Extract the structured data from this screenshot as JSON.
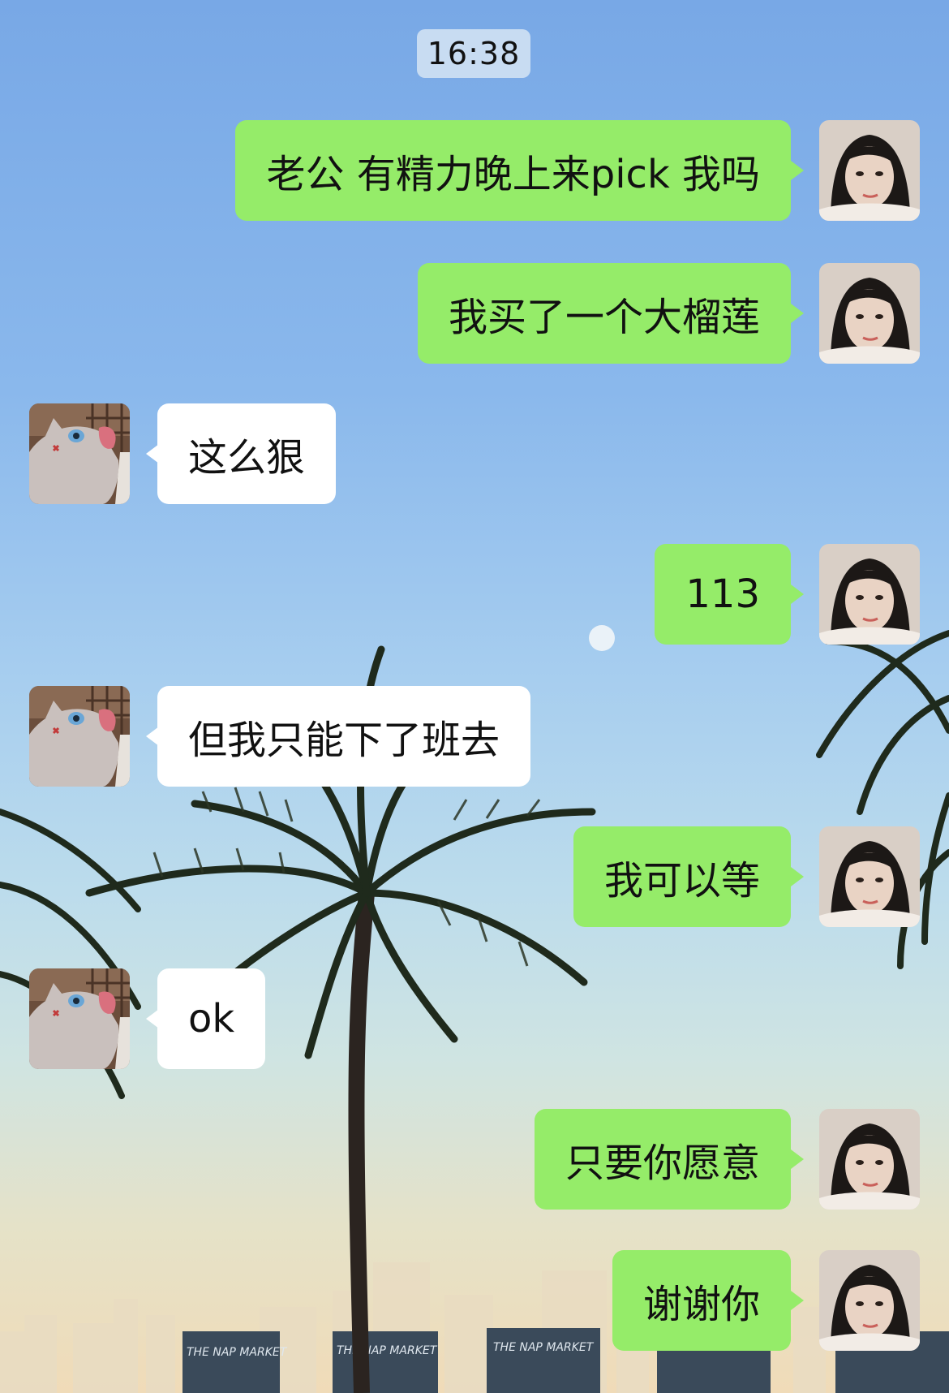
{
  "chat": {
    "timestamp": "16:38",
    "messages": [
      {
        "from": "me",
        "text": "老公 有精力晚上来pick 我吗"
      },
      {
        "from": "me",
        "text": "我买了一个大榴莲"
      },
      {
        "from": "them",
        "text": "这么狠"
      },
      {
        "from": "me",
        "text": "113"
      },
      {
        "from": "them",
        "text": "但我只能下了班去"
      },
      {
        "from": "me",
        "text": "我可以等"
      },
      {
        "from": "them",
        "text": "ok"
      },
      {
        "from": "me",
        "text": "只要你愿意"
      },
      {
        "from": "me",
        "text": "谢谢你"
      }
    ]
  },
  "colors": {
    "my_bubble": "#95ec69",
    "their_bubble": "#ffffff",
    "timestamp_bg": "#dce8f5"
  },
  "background": {
    "banner_text": [
      "THE NAP MARKET",
      "THE NAP MARKET",
      "THE NAP MARKET"
    ]
  }
}
